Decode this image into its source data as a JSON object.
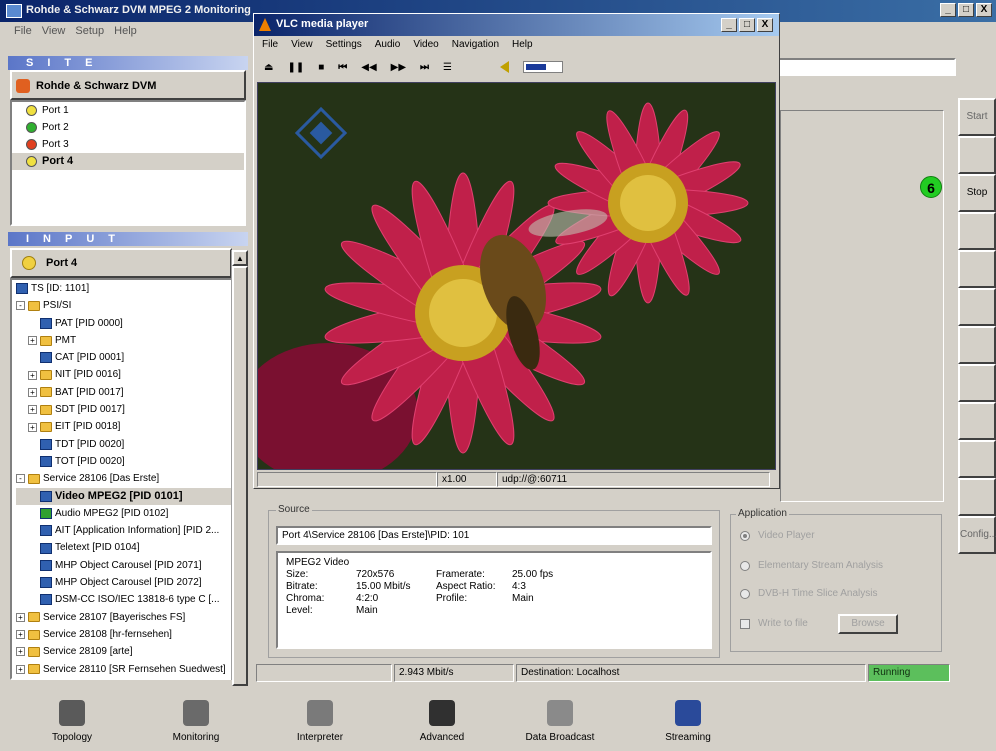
{
  "app": {
    "title": "Rohde & Schwarz DVM MPEG 2 Monitoring",
    "menu": [
      "File",
      "View",
      "Setup",
      "Help"
    ],
    "window_controls": [
      "_",
      "□",
      "X"
    ]
  },
  "site": {
    "header": "SITE",
    "root": "Rohde & Schwarz DVM",
    "ports": [
      {
        "label": "Port 1",
        "color": "#f0e040"
      },
      {
        "label": "Port 2",
        "color": "#30b030"
      },
      {
        "label": "Port 3",
        "color": "#e04020"
      },
      {
        "label": "Port 4",
        "color": "#f0e040"
      }
    ]
  },
  "input": {
    "header": "INPUT",
    "root": "Port 4",
    "items": [
      {
        "label": "TS [ID: 1101]",
        "indent": 0,
        "icon": "ts-icon",
        "expander": ""
      },
      {
        "label": "PSI/SI",
        "indent": 0,
        "icon": "folder-icon",
        "expander": "-"
      },
      {
        "label": "PAT [PID 0000]",
        "indent": 2,
        "icon": "pid-icon",
        "expander": ""
      },
      {
        "label": "PMT",
        "indent": 1,
        "icon": "folder-icon",
        "expander": "+"
      },
      {
        "label": "CAT [PID 0001]",
        "indent": 2,
        "icon": "pid-icon",
        "expander": ""
      },
      {
        "label": "NIT [PID 0016]",
        "indent": 1,
        "icon": "folder-icon",
        "expander": "+"
      },
      {
        "label": "BAT [PID 0017]",
        "indent": 1,
        "icon": "folder-icon",
        "expander": "+"
      },
      {
        "label": "SDT [PID 0017]",
        "indent": 1,
        "icon": "folder-icon",
        "expander": "+"
      },
      {
        "label": "EIT [PID 0018]",
        "indent": 1,
        "icon": "folder-icon",
        "expander": "+"
      },
      {
        "label": "TDT [PID 0020]",
        "indent": 2,
        "icon": "pid-icon",
        "expander": ""
      },
      {
        "label": "TOT [PID 0020]",
        "indent": 2,
        "icon": "pid-icon",
        "expander": ""
      },
      {
        "label": "Service 28106 [Das Erste]",
        "indent": 0,
        "icon": "folder-icon",
        "expander": "-"
      },
      {
        "label": "Video MPEG2 [PID 0101]",
        "indent": 2,
        "icon": "pid-icon",
        "expander": "",
        "selected": true
      },
      {
        "label": "Audio MPEG2 [PID 0102]",
        "indent": 2,
        "icon": "audio-icon",
        "expander": ""
      },
      {
        "label": "AIT [Application Information] [PID 2...",
        "indent": 2,
        "icon": "pid-icon",
        "expander": ""
      },
      {
        "label": "Teletext [PID 0104]",
        "indent": 2,
        "icon": "pid-icon",
        "expander": ""
      },
      {
        "label": "MHP Object Carousel [PID 2071]",
        "indent": 2,
        "icon": "pid-icon",
        "expander": ""
      },
      {
        "label": "MHP Object Carousel [PID 2072]",
        "indent": 2,
        "icon": "pid-icon",
        "expander": ""
      },
      {
        "label": "DSM-CC ISO/IEC 13818-6 type C [...",
        "indent": 2,
        "icon": "pid-icon",
        "expander": ""
      },
      {
        "label": "Service 28107 [Bayerisches FS]",
        "indent": 0,
        "icon": "folder-icon",
        "expander": "+"
      },
      {
        "label": "Service 28108 [hr-fernsehen]",
        "indent": 0,
        "icon": "folder-icon",
        "expander": "+"
      },
      {
        "label": "Service 28109 [arte]",
        "indent": 0,
        "icon": "folder-icon",
        "expander": "+"
      },
      {
        "label": "Service 28110 [SR Fernsehen Suedwest]",
        "indent": 0,
        "icon": "folder-icon",
        "expander": "+"
      }
    ]
  },
  "side_buttons": {
    "start": "Start",
    "stop": "Stop",
    "config": "Config..."
  },
  "badge": "6",
  "vlc": {
    "title": "VLC media player",
    "menu": [
      "File",
      "View",
      "Settings",
      "Audio",
      "Video",
      "Navigation",
      "Help"
    ],
    "toolbar": [
      "⏏",
      "❚❚",
      "■",
      "⏮",
      "◀◀",
      "▶▶",
      "⏭",
      "☰"
    ],
    "volume_level": 0.6,
    "status_speed": "x1.00",
    "status_stream": "udp://@:60711"
  },
  "source": {
    "label": "Source",
    "path": "Port 4\\Service 28106 [Das Erste]\\PID: 101",
    "codec": "MPEG2 Video",
    "fields": [
      {
        "k": "Size:",
        "v": "720x576",
        "k2": "Framerate:",
        "v2": "25.00 fps"
      },
      {
        "k": "Bitrate:",
        "v": "15.00 Mbit/s",
        "k2": "Aspect Ratio:",
        "v2": "4:3"
      },
      {
        "k": "Chroma:",
        "v": "4:2:0",
        "k2": "Profile:",
        "v2": "Main"
      },
      {
        "k": "Level:",
        "v": "Main",
        "k2": "",
        "v2": ""
      }
    ]
  },
  "application": {
    "label": "Application",
    "options": [
      {
        "label": "Video Player",
        "selected": true
      },
      {
        "label": "Elementary Stream Analysis",
        "selected": false
      },
      {
        "label": "DVB-H Time Slice Analysis",
        "selected": false
      }
    ],
    "write_to_file": "Write to file",
    "browse": "Browse"
  },
  "status": {
    "bitrate": "2.943 Mbit/s",
    "destination": "Destination: Localhost",
    "state": "Running"
  },
  "toolbar": [
    {
      "label": "Topology",
      "icon": "topology-icon",
      "color": "#5a5a5a"
    },
    {
      "label": "Monitoring",
      "icon": "monitoring-icon",
      "color": "#6a6a6a"
    },
    {
      "label": "Interpreter",
      "icon": "interpreter-icon",
      "color": "#7a7a7a"
    },
    {
      "label": "Advanced",
      "icon": "advanced-icon",
      "color": "#303030"
    },
    {
      "label": "Data Broadcast",
      "icon": "data-broadcast-icon",
      "color": "#8a8a8a"
    },
    {
      "label": "Streaming",
      "icon": "streaming-icon",
      "color": "#2a4a9a"
    }
  ]
}
